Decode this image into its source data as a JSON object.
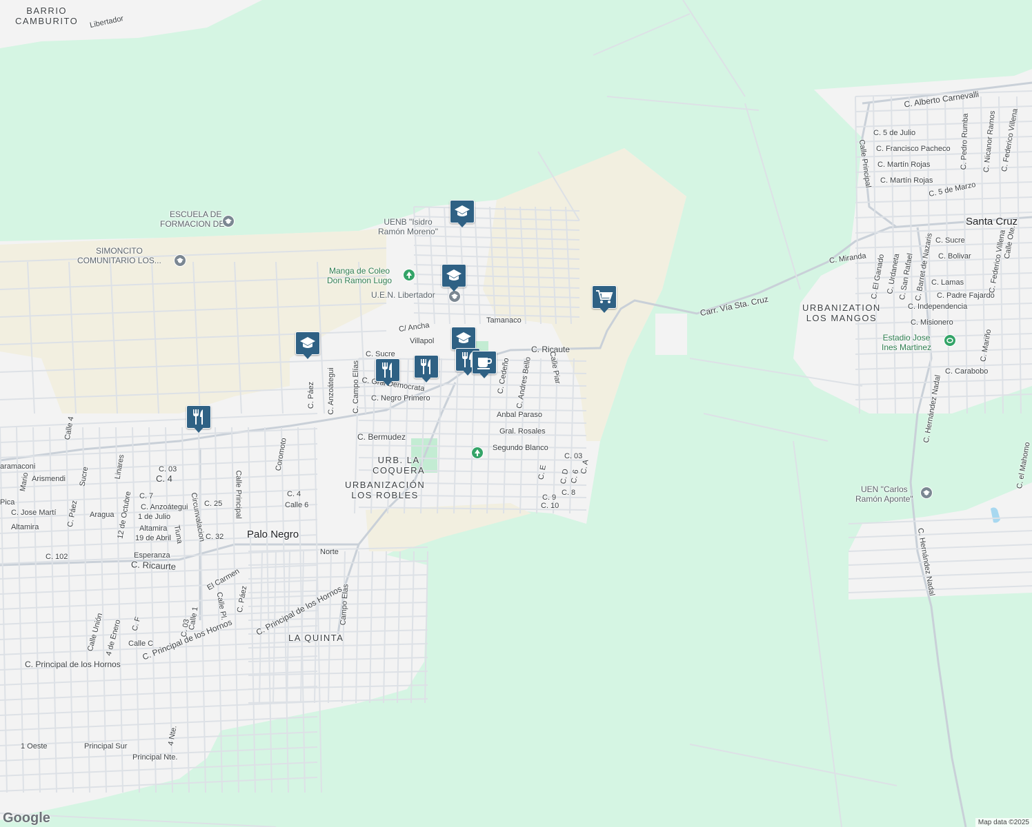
{
  "map": {
    "attribution": "Map data ©2025",
    "logo": "Google",
    "colors": {
      "vegetation": "#d5f5e3",
      "urban": "#f3f3f3",
      "sand": "#f2efe0",
      "road": "#dde1e6",
      "road_major": "#c9d0d8",
      "pin": "#2f6184",
      "water": "#a8d8f0"
    }
  },
  "areas": {
    "barrio_camburito": "BARRIO\nCAMBURITO",
    "urb_la_coquera": "URB. LA\nCOQUERA",
    "urb_los_robles": "URBANIZACIÓN\nLOS ROBLES",
    "la_quinta": "LA QUINTA",
    "urb_los_mangos": "URBANIZATION\nLOS MANGOS",
    "palo_negro": "Palo Negro",
    "santa_cruz": "Santa Cruz"
  },
  "pois": {
    "escuela": "ESCUELA DE\nFORMACION DE...",
    "simoncito": "SIMONCITO\nCOMUNITARIO LOS...",
    "uenb": "UENB \"Isidro\nRamón Moreno\"",
    "manga": "Manga de Coleo\nDon Ramon Lugo",
    "uen_libertador": "U.E.N. Libertador",
    "estadio": "Estadio Jose\nInes Martinez",
    "uen_carlos": "UEN \"Carlos\nRamón Aponte\""
  },
  "streets": {
    "libertador": "Libertador",
    "c_ancha": "C/ Ancha",
    "tamanaco": "Tamanaco",
    "villapol": "Villapol",
    "c_ricaute": "C. Ricaute",
    "c_sucre_w": "C. Sucre",
    "c_gral_democrata": "C. Gral Democrata",
    "c_negro_primero": "C. Negro Primero",
    "c_bermudez": "C. Bermudez",
    "c_paez": "C. Páez",
    "c_anzoategui": "C. Anzoátegui",
    "c_campo_elias": "C. Campo Elías",
    "calle_4": "Calle 4",
    "coromoto": "Coromoto",
    "c_cedeno": "C. Cedeño",
    "c_andres_bello": "C. Andres Bello",
    "calle_piar": "Calle Piar",
    "anbal_paraso": "Anbal Paraso",
    "gral_rosales": "Gral. Rosales",
    "segundo_blanco": "Segundo Blanco",
    "c_03": "C. 03",
    "c_e": "C. E",
    "c_d": "C. D",
    "c_6": "C. 6",
    "c_a": "C. A",
    "c_8": "C. 8",
    "c_9": "C. 9",
    "c_10": "C. 10",
    "aramaconi": "aramaconi",
    "c_03_w": "C. 03",
    "c_4_w": "C. 4",
    "mario": "Mario",
    "arismendi": "Arismendi",
    "sucre_v": "Sucre",
    "linares": "Linares",
    "calle_principal_v": "Calle Principal",
    "c_4_b": "C. 4",
    "calle_6": "Calle 6",
    "c_25": "C. 25",
    "c_7": "C. 7",
    "c_anzoategui_2": "C. Anzoátegui",
    "doce_octubre": "12 de Octubre",
    "uno_julio": "1 de Julio",
    "altamira_h": "Altamira",
    "diecinueve_abril": "19 de Abril",
    "tiuna": "Tiuna",
    "circunvalacion": "Circunvalacion",
    "c_32": "C. 32",
    "pica": "Pica",
    "c_jose_marti": "C. Jose Martí",
    "c_paez_2": "C. Páez",
    "aragua": "Aragua",
    "altamira": "Altamira",
    "esperanza": "Esperanza",
    "c_102": "C. 102",
    "c_ricaurte": "C. Ricaurte",
    "norte": "Norte",
    "el_carmen": "El Carmen",
    "c_paez_3": "C. Páez",
    "calle_pl": "Calle Pl.",
    "calle_1": "Calle 1",
    "c_03_b": "C. 03",
    "c_principal_hornos_1": "C. Principal de los Hornos",
    "c_principal_hornos_2": "C. Principal de los Hornos",
    "c_principal_hornos_3": "C. Principal de los Hornos",
    "campo_elas": "Campo Elas",
    "calle_union": "Calle Unión",
    "cuatro_enero": "4 de Enero",
    "c_f": "C. F",
    "calle_c": "Calle C",
    "uno_oeste": "1 Oeste",
    "principal_sur": "Principal Sur",
    "principal_nte": "Principal Nte.",
    "cuatro_nte": "4 Nte.",
    "carr_via_sta_cruz": "Carr. Vía Sta. Cruz",
    "c_alberto_carnevalli": "C. Alberto Carnevalli",
    "c_5_julio": "C. 5 de Julio",
    "c_francisco_pacheco": "C. Francisco Pacheco",
    "c_martin_rojas_1": "C. Martín Rojas",
    "c_martin_rojas_2": "C. Martín Rojas",
    "c_5_marzo": "C. 5 de Marzo",
    "calle_principal_e": "Calle Principal",
    "pedro_rumba": "C. Pedro Rumba",
    "nicanor_ramos": "C. Nicanor Ramos",
    "federico_villena": "C. Federico Villena",
    "c_sucre_e": "C. Sucre",
    "c_bolivar": "C. Bolivar",
    "c_miranda": "C. Miranda",
    "c_el_ganado": "C. El Ganado",
    "c_urdaneta": "C. Urdaneta",
    "c_san_rafael": "C. San Rafael",
    "c_barret": "C. Barret de Nazaris",
    "c_lamas": "C. Lamas",
    "c_padre_fajardo": "C. Padre Fajardo",
    "c_independencia": "C. Independencia",
    "c_misionero": "C. Misionero",
    "c_federico_villena_2": "C. Federico Villena",
    "calle_ote": "Calle Ote.",
    "c_marino": "C. Mariño",
    "c_carabobo": "C. Carabobo",
    "c_hernandez_nadal_1": "C. Hernández Nadal",
    "c_hernandez_nadal_2": "C. Hernández Nadal",
    "c_el_mahomo": "C. el Mahomo"
  },
  "markers": [
    {
      "name": "school-marker-uenb",
      "icon": "graduation-cap-icon"
    },
    {
      "name": "school-marker-libertador",
      "icon": "graduation-cap-icon"
    },
    {
      "name": "school-marker-west",
      "icon": "graduation-cap-icon"
    },
    {
      "name": "school-marker-center",
      "icon": "graduation-cap-icon"
    },
    {
      "name": "restaurant-marker-1",
      "icon": "fork-knife-icon"
    },
    {
      "name": "restaurant-marker-2",
      "icon": "fork-knife-icon"
    },
    {
      "name": "restaurant-marker-3",
      "icon": "fork-knife-icon"
    },
    {
      "name": "restaurant-marker-4",
      "icon": "fork-knife-icon"
    },
    {
      "name": "cafe-marker",
      "icon": "coffee-cup-icon"
    },
    {
      "name": "shopping-marker",
      "icon": "shopping-cart-icon"
    }
  ]
}
